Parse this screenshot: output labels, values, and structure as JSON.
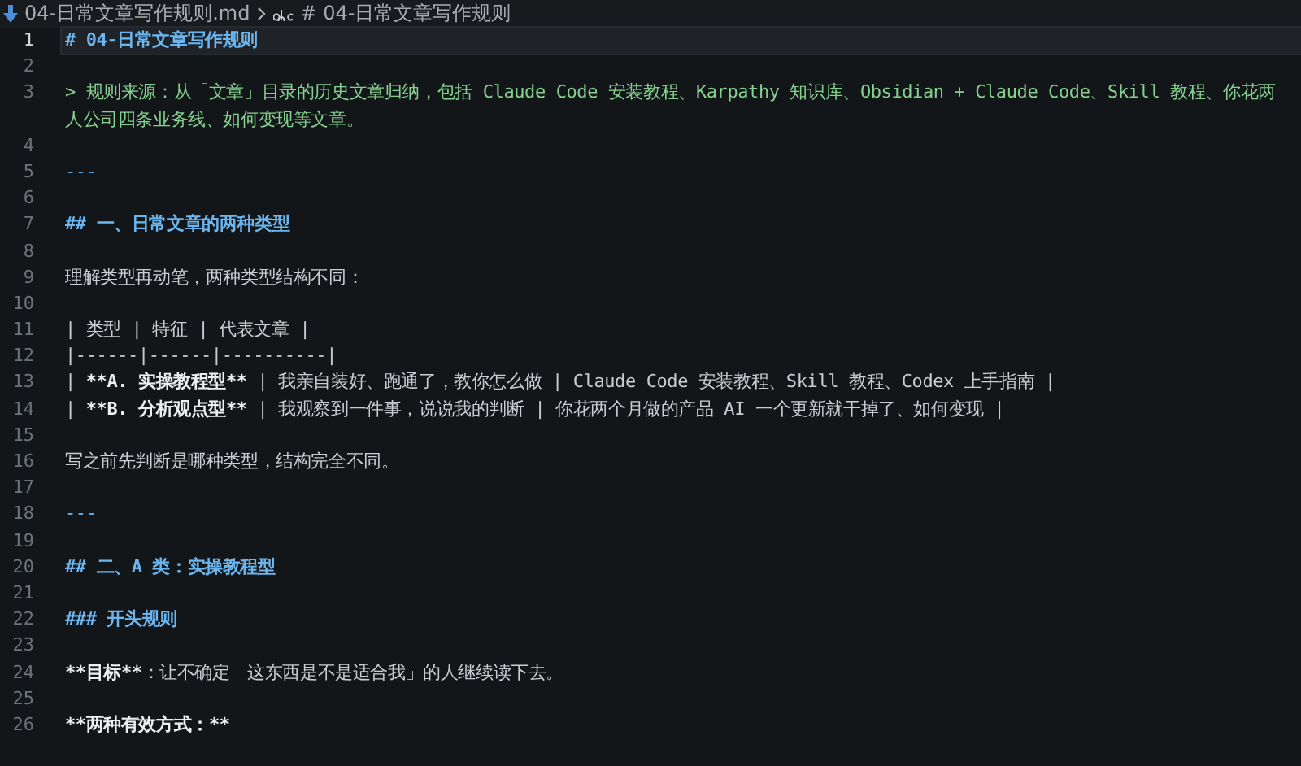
{
  "breadcrumb": {
    "file": "04-日常文章写作规则.md",
    "symbol": "# 04-日常文章写作规则"
  },
  "lines": [
    {
      "number": "1",
      "current": true,
      "segments": [
        {
          "kind": "heading",
          "text": "# 04-日常文章写作规则"
        }
      ]
    },
    {
      "number": "2",
      "current": false
    },
    {
      "number": "3",
      "current": false,
      "segments": [
        {
          "kind": "quote",
          "text": "> 规则来源：从「文章」目录的历史文章归纳，包括 Claude Code 安装教程、Karpathy 知识库、Obsidian + Claude Code、Skill 教程、你花两"
        }
      ],
      "wrapped": [
        {
          "kind": "quote",
          "text": "人公司四条业务线、如何变现等文章。"
        }
      ]
    },
    {
      "number": "4",
      "current": false
    },
    {
      "number": "5",
      "current": false,
      "segments": [
        {
          "kind": "rule",
          "text": "---"
        }
      ]
    },
    {
      "number": "6",
      "current": false
    },
    {
      "number": "7",
      "current": false,
      "segments": [
        {
          "kind": "heading",
          "text": "## 一、日常文章的两种类型"
        }
      ]
    },
    {
      "number": "8",
      "current": false
    },
    {
      "number": "9",
      "current": false,
      "segments": [
        {
          "kind": "text",
          "text": "理解类型再动笔，两种类型结构不同："
        }
      ]
    },
    {
      "number": "10",
      "current": false
    },
    {
      "number": "11",
      "current": false,
      "segments": [
        {
          "kind": "text",
          "text": "| 类型 | 特征 | 代表文章 |"
        }
      ]
    },
    {
      "number": "12",
      "current": false,
      "segments": [
        {
          "kind": "text",
          "text": "|------|------|----------|"
        }
      ]
    },
    {
      "number": "13",
      "current": false,
      "segments": [
        {
          "kind": "text",
          "text": "| "
        },
        {
          "kind": "bold",
          "text": "**A. 实操教程型**"
        },
        {
          "kind": "text",
          "text": " | 我亲自装好、跑通了，教你怎么做 | Claude Code 安装教程、Skill 教程、Codex 上手指南 |"
        }
      ]
    },
    {
      "number": "14",
      "current": false,
      "segments": [
        {
          "kind": "text",
          "text": "| "
        },
        {
          "kind": "bold",
          "text": "**B. 分析观点型**"
        },
        {
          "kind": "text",
          "text": " | 我观察到一件事，说说我的判断 | 你花两个月做的产品 AI 一个更新就干掉了、如何变现 |"
        }
      ]
    },
    {
      "number": "15",
      "current": false
    },
    {
      "number": "16",
      "current": false,
      "segments": [
        {
          "kind": "text",
          "text": "写之前先判断是哪种类型，结构完全不同。"
        }
      ]
    },
    {
      "number": "17",
      "current": false
    },
    {
      "number": "18",
      "current": false,
      "segments": [
        {
          "kind": "rule",
          "text": "---"
        }
      ]
    },
    {
      "number": "19",
      "current": false
    },
    {
      "number": "20",
      "current": false,
      "segments": [
        {
          "kind": "heading",
          "text": "## 二、A 类：实操教程型"
        }
      ]
    },
    {
      "number": "21",
      "current": false
    },
    {
      "number": "22",
      "current": false,
      "segments": [
        {
          "kind": "heading",
          "text": "### 开头规则"
        }
      ]
    },
    {
      "number": "23",
      "current": false
    },
    {
      "number": "24",
      "current": false,
      "segments": [
        {
          "kind": "bold",
          "text": "**目标**"
        },
        {
          "kind": "text",
          "text": "：让不确定「这东西是不是适合我」的人继续读下去。"
        }
      ]
    },
    {
      "number": "25",
      "current": false
    },
    {
      "number": "26",
      "current": false,
      "segments": [
        {
          "kind": "bold",
          "text": "**两种有效方式：**"
        }
      ]
    }
  ]
}
